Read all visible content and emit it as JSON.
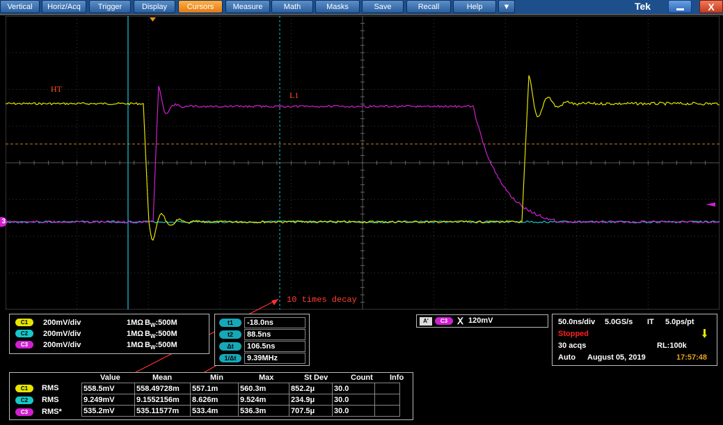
{
  "menubar": {
    "items": [
      "Vertical",
      "Horiz/Acq",
      "Trigger",
      "Display",
      "Cursors",
      "Measure",
      "Math",
      "Masks",
      "Save",
      "Recall",
      "Help",
      "▼"
    ],
    "active": "Cursors",
    "brand": "Tek",
    "close_glyph": "X"
  },
  "waveform": {
    "labels": {
      "ht": "HT",
      "l1": "L1",
      "annotation": "10 times decay"
    },
    "ground_marker": "3",
    "colors": {
      "c1": "#e5e500",
      "c2": "#16c8c8",
      "c3": "#d020d0",
      "cursor_solid": "#18c8d8",
      "cursor_dashed": "#18c8d8",
      "hcursor": "#d08020",
      "annotation": "#ff3030"
    }
  },
  "channels": [
    {
      "badge": "C1",
      "scale": "200mV/div",
      "impedance": "1MΩ",
      "bw": "B",
      "bw_sub": "W",
      "bw_val": ":500M"
    },
    {
      "badge": "C2",
      "scale": "200mV/div",
      "impedance": "1MΩ",
      "bw": "B",
      "bw_sub": "W",
      "bw_val": ":500M"
    },
    {
      "badge": "C3",
      "scale": "200mV/div",
      "impedance": "1MΩ",
      "bw": "B",
      "bw_sub": "W",
      "bw_val": ":500M"
    }
  ],
  "cursors": [
    {
      "label": "t1",
      "value": "-18.0ns"
    },
    {
      "label": "t2",
      "value": "88.5ns"
    },
    {
      "label": "Δt",
      "value": "106.5ns"
    },
    {
      "label": "1/Δt",
      "value": "9.39MHz"
    }
  ],
  "trigger": {
    "source_a": "A'",
    "source": "C3",
    "symbol": "Ⅹ",
    "level": "120mV"
  },
  "acquisition": {
    "timebase": "50.0ns/div",
    "rate": "5.0GS/s",
    "mode": "IT",
    "resolution": "5.0ps/pt",
    "state": "Stopped",
    "acqs": "30 acqs",
    "record": "RL:100k",
    "trigger_mode": "Auto",
    "date": "August 05, 2019",
    "time": "17:57:48"
  },
  "measurements": {
    "headers": [
      "Value",
      "Mean",
      "Min",
      "Max",
      "St Dev",
      "Count",
      "Info"
    ],
    "rows": [
      {
        "badge": "C1",
        "name": "RMS",
        "cells": [
          "558.5mV",
          "558.49728m",
          "557.1m",
          "560.3m",
          "852.2μ",
          "30.0",
          ""
        ]
      },
      {
        "badge": "C2",
        "name": "RMS",
        "cells": [
          "9.249mV",
          "9.1552156m",
          "8.626m",
          "9.524m",
          "234.9μ",
          "30.0",
          ""
        ]
      },
      {
        "badge": "C3",
        "name": "RMS*",
        "cells": [
          "535.2mV",
          "535.11577m",
          "533.4m",
          "536.3m",
          "707.5μ",
          "30.0",
          ""
        ]
      }
    ]
  }
}
